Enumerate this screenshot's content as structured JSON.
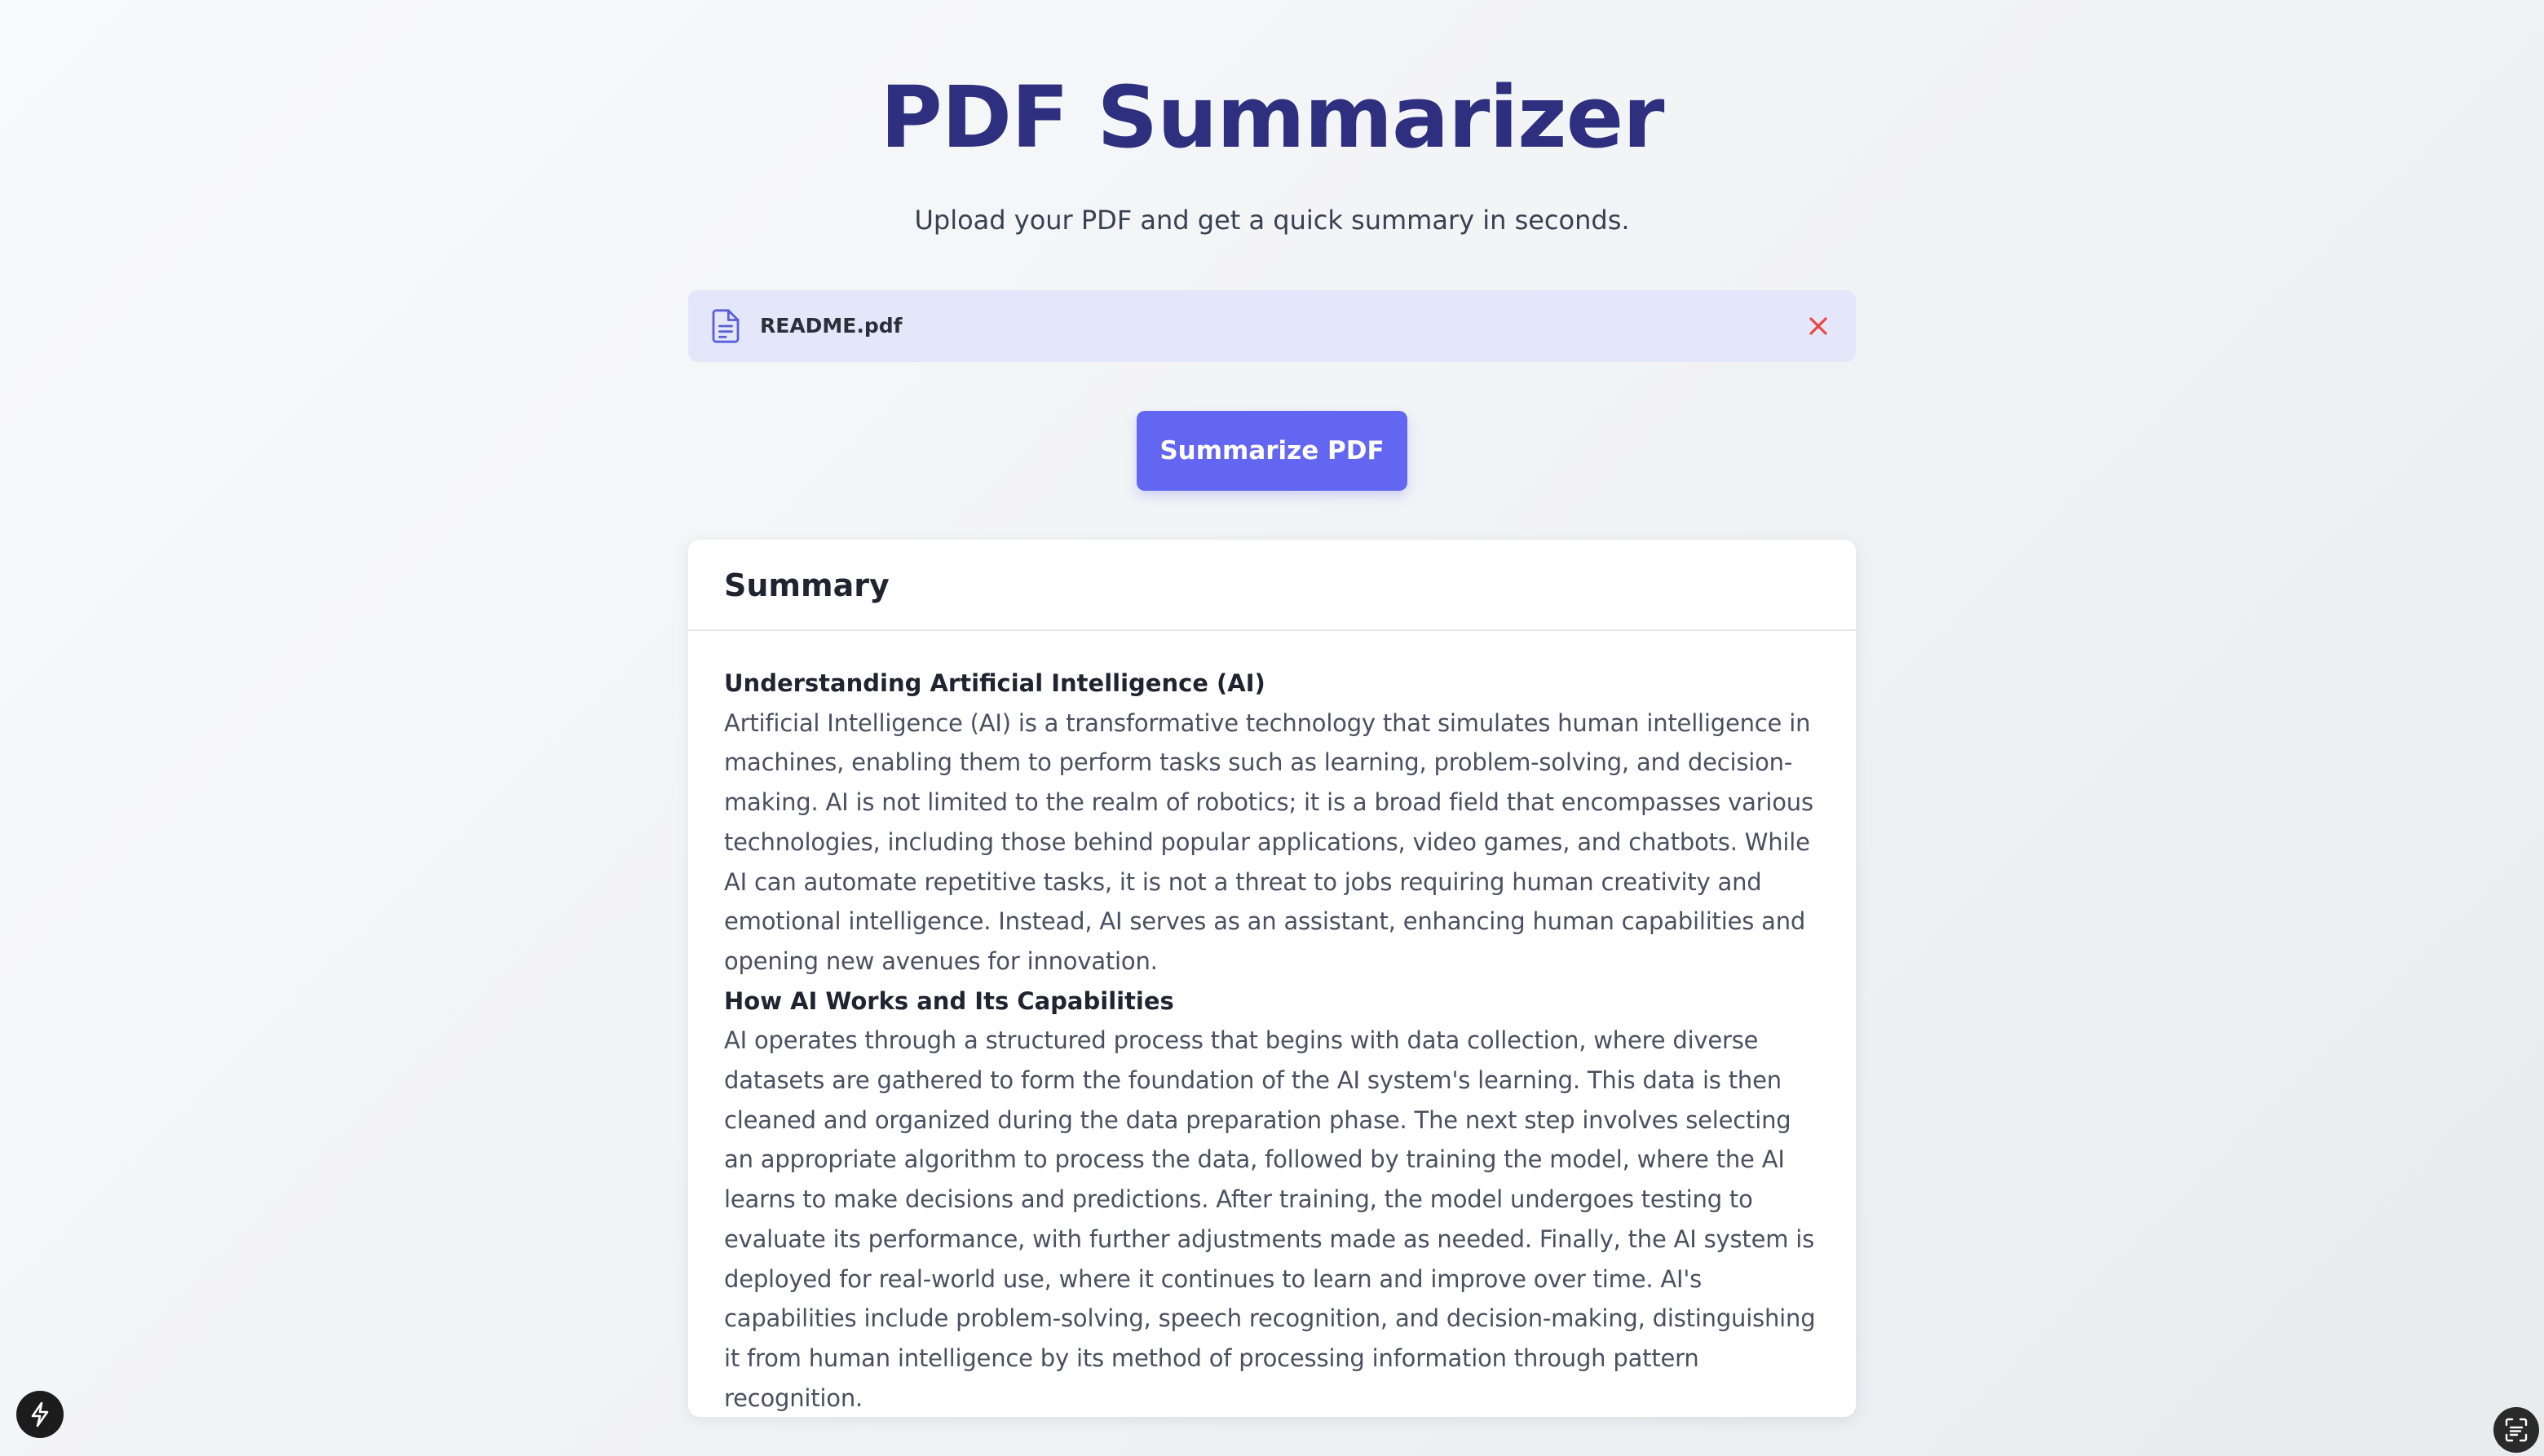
{
  "header": {
    "title": "PDF Summarizer",
    "subtitle": "Upload your PDF and get a quick summary in seconds."
  },
  "upload": {
    "file_name": "README.pdf",
    "file_icon": "document-icon",
    "remove_icon": "close-icon"
  },
  "actions": {
    "summarize_label": "Summarize PDF"
  },
  "summary": {
    "title": "Summary",
    "sections": [
      {
        "heading": "Understanding Artificial Intelligence (AI)",
        "text": "Artificial Intelligence (AI) is a transformative technology that simulates human intelligence in machines, enabling them to perform tasks such as learning, problem-solving, and decision-making. AI is not limited to the realm of robotics; it is a broad field that encompasses various technologies, including those behind popular applications, video games, and chatbots. While AI can automate repetitive tasks, it is not a threat to jobs requiring human creativity and emotional intelligence. Instead, AI serves as an assistant, enhancing human capabilities and opening new avenues for innovation."
      },
      {
        "heading": "How AI Works and Its Capabilities",
        "text": "AI operates through a structured process that begins with data collection, where diverse datasets are gathered to form the foundation of the AI system's learning. This data is then cleaned and organized during the data preparation phase. The next step involves selecting an appropriate algorithm to process the data, followed by training the model, where the AI learns to make decisions and predictions. After training, the model undergoes testing to evaluate its performance, with further adjustments made as needed. Finally, the AI system is deployed for real-world use, where it continues to learn and improve over time. AI's capabilities include problem-solving, speech recognition, and decision-making, distinguishing it from human intelligence by its method of processing information through pattern recognition."
      }
    ]
  },
  "colors": {
    "title": "#2e2f7e",
    "accent": "#6366f1",
    "file_row_bg": "#e3e7f9",
    "remove": "#ef4444"
  },
  "floating": {
    "left_icon": "lightning-bolt-icon",
    "right_icon": "scan-text-icon"
  }
}
